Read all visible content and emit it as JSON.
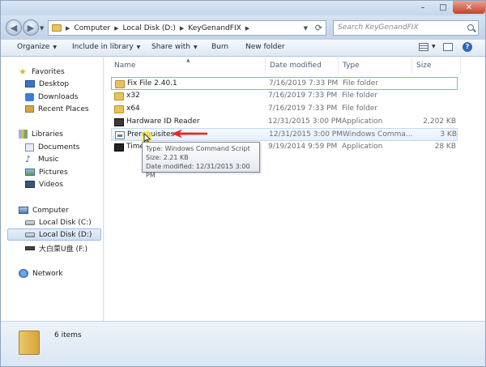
{
  "address": {
    "crumbs": [
      "Computer",
      "Local Disk (D:)",
      "KeyGenandFIX"
    ],
    "search_placeholder": "Search KeyGenandFIX"
  },
  "titlebar": {
    "minimize": "–",
    "maximize": "□",
    "close": "✕"
  },
  "toolbar": {
    "organize": "Organize",
    "include": "Include in library",
    "share": "Share with",
    "burn": "Burn",
    "new_folder": "New folder",
    "help": "?"
  },
  "nav": {
    "favorites": "Favorites",
    "desktop": "Desktop",
    "downloads": "Downloads",
    "recent": "Recent Places",
    "libraries": "Libraries",
    "documents": "Documents",
    "music": "Music",
    "pictures": "Pictures",
    "videos": "Videos",
    "computer": "Computer",
    "disk_c": "Local Disk (C:)",
    "disk_d": "Local Disk (D:)",
    "disk_f": "大白菜U盘 (F:)",
    "network": "Network"
  },
  "columns": {
    "name": "Name",
    "date": "Date modified",
    "type": "Type",
    "size": "Size"
  },
  "files": [
    {
      "name": "Fix File 2.40.1",
      "date": "7/16/2019 7:33 PM",
      "type": "File folder",
      "size": ""
    },
    {
      "name": "x32",
      "date": "7/16/2019 7:33 PM",
      "type": "File folder",
      "size": ""
    },
    {
      "name": "x64",
      "date": "7/16/2019 7:33 PM",
      "type": "File folder",
      "size": ""
    },
    {
      "name": "Hardware ID Reader",
      "date": "12/31/2015 3:00 PM",
      "type": "Application",
      "size": "2,202 KB"
    },
    {
      "name": "Prerequisites",
      "date": "12/31/2015 3:00 PM",
      "type": "Windows Comma...",
      "size": "3 KB"
    },
    {
      "name": "Time",
      "date": "9/19/2014 9:59 PM",
      "type": "Application",
      "size": "28 KB"
    }
  ],
  "tooltip": {
    "type": "Type: Windows Command Script",
    "size": "Size: 2.21 KB",
    "date": "Date modified: 12/31/2015 3:00 PM"
  },
  "details": {
    "count": "6 items"
  },
  "colors": {
    "accent": "#3d73c4",
    "annotation_arrow": "#e02a22",
    "cursor_highlight": "#fff640"
  }
}
